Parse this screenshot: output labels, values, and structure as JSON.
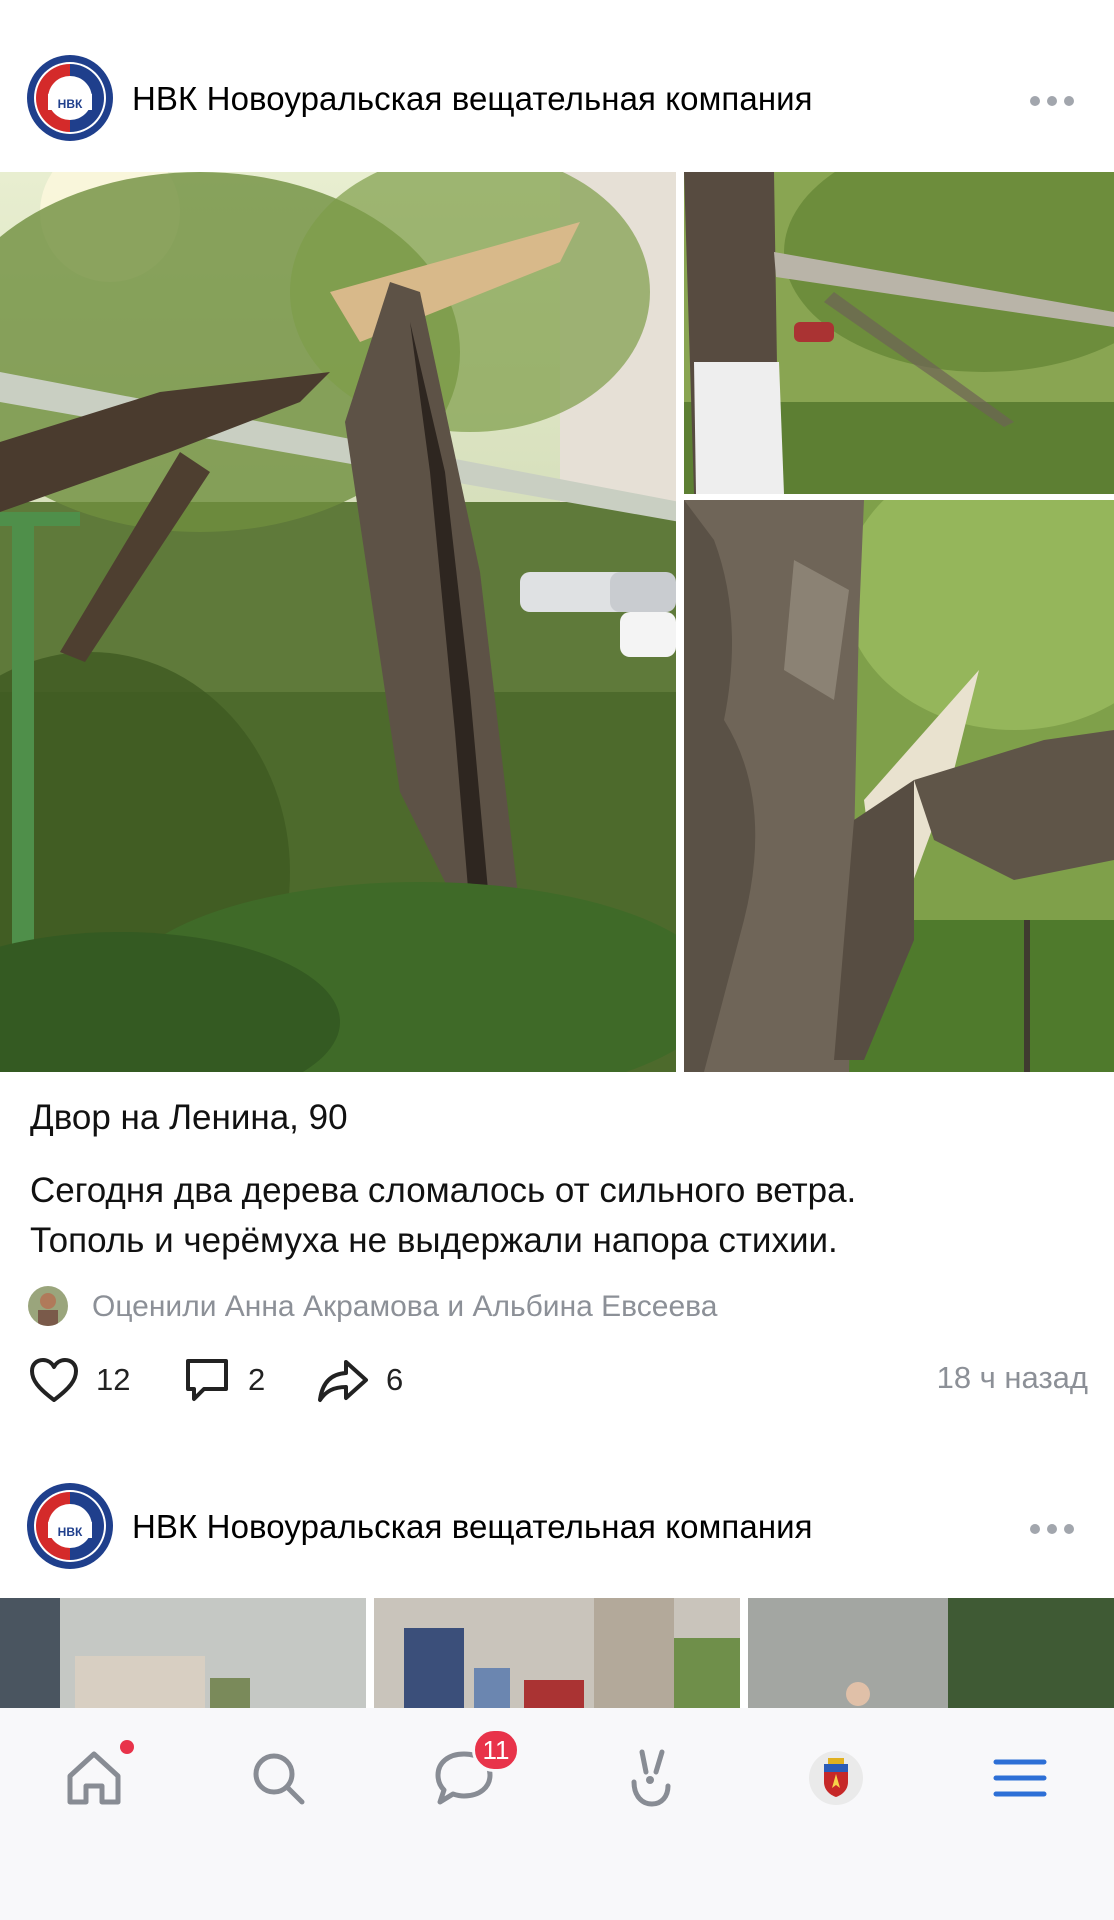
{
  "post1": {
    "author": "НВК Новоуральская вещательная компания",
    "avatar_label": "НВК",
    "more_icon": "ellipsis-icon",
    "caption_title": "Двор на Ленина, 90",
    "caption_lines": [
      "Сегодня два дерева сломалось от сильного ветра.",
      "Тополь и черёмуха не выдержали напора стихии."
    ],
    "liked_text": "Оценили Анна Акрамова и Альбина Евсеева",
    "likes": "12",
    "comments": "2",
    "shares": "6",
    "time": "18 ч назад"
  },
  "post2": {
    "author": "НВК Новоуральская вещательная компания",
    "avatar_label": "НВК"
  },
  "tabbar": {
    "messages_badge": "11",
    "items": [
      "home-icon",
      "search-icon",
      "messages-icon",
      "clips-icon",
      "profile-icon",
      "menu-icon"
    ]
  },
  "colors": {
    "brand_red": "#d42a2a",
    "brand_blue": "#1f3f8c",
    "accent_blue": "#2d6fd6",
    "badge_red": "#e8334a",
    "meta_gray": "#8c9097"
  }
}
